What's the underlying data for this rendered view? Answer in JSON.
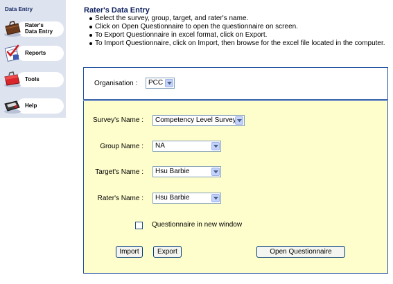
{
  "sidebar": {
    "title": "Data Entry",
    "items": [
      {
        "label_line1": "Rater's",
        "label_line2": "Data Entry",
        "icon": "briefcase-icon"
      },
      {
        "label_line1": "Reports",
        "label_line2": "",
        "icon": "report-checklist-icon"
      },
      {
        "label_line1": "Tools",
        "label_line2": "",
        "icon": "toolbox-icon"
      },
      {
        "label_line1": "Help",
        "label_line2": "",
        "icon": "help-device-icon"
      }
    ]
  },
  "header": {
    "title": "Rater's Data Entry",
    "instructions": [
      "Select the survey, group, target, and rater's name.",
      "Click on Open Questionnaire to open the questionnaire on screen.",
      "To Export Questionnaire in excel format, click on Export.",
      "To Import Questionnaire, click on Import, then browse for the excel file located in the computer."
    ]
  },
  "organisation": {
    "label": "Organisation :",
    "value": "PCC"
  },
  "form": {
    "survey": {
      "label": "Survey's Name :",
      "value": "Competency Level Survey"
    },
    "group": {
      "label": "Group Name :",
      "value": "NA"
    },
    "target": {
      "label": "Target's Name :",
      "value": "Hsu Barbie"
    },
    "rater": {
      "label": "Rater's Name :",
      "value": "Hsu Barbie"
    },
    "new_window": {
      "label": "Questionnaire in new window",
      "checked": false
    },
    "buttons": {
      "import": "Import",
      "export": "Export",
      "open": "Open Questionnaire"
    }
  },
  "colors": {
    "sidebar_bg": "#dde3ef",
    "title_blue": "#0c1f5c",
    "panel_border": "#1f4f9f",
    "form_bg": "#fefdcc"
  }
}
